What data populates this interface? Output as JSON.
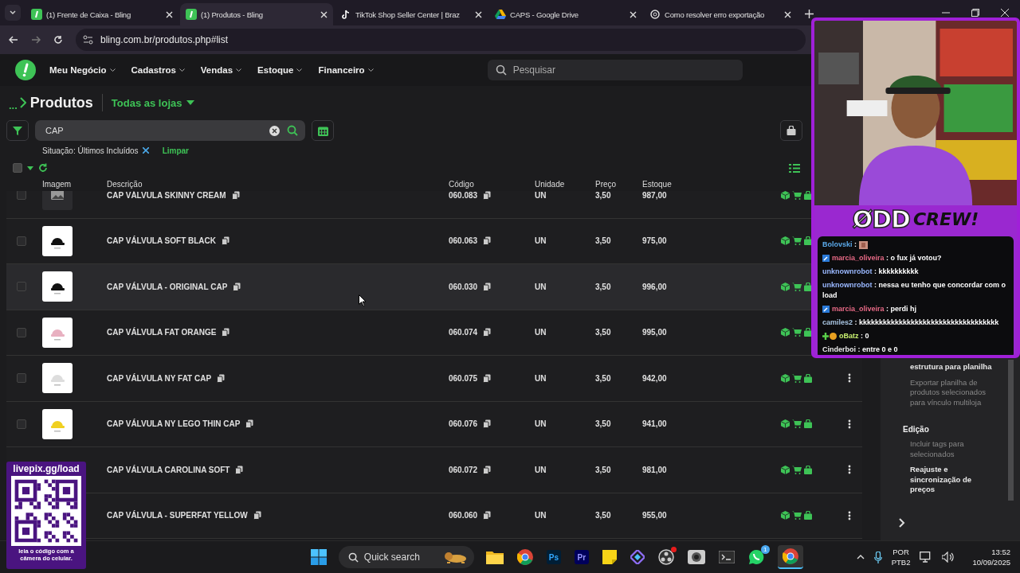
{
  "browser": {
    "tabs": [
      {
        "title": "(1) Frente de Caixa - Bling",
        "selected": false
      },
      {
        "title": "(1) Produtos - Bling",
        "selected": true
      },
      {
        "title": "TikTok Shop Seller Center | Braz",
        "selected": false
      },
      {
        "title": "CAPS - Google Drive",
        "selected": false
      },
      {
        "title": "Como resolver erro exportação",
        "selected": false
      }
    ],
    "url": "bling.com.br/produtos.php#list"
  },
  "nav": {
    "menu": [
      "Meu Negócio",
      "Cadastros",
      "Vendas",
      "Estoque",
      "Financeiro"
    ],
    "search_placeholder": "Pesquisar"
  },
  "page": {
    "breadcrumb": "...",
    "title": "Produtos",
    "store_filter": "Todas as lojas",
    "search_value": "CAP",
    "filter_label": "Situação: Últimos Incluídos",
    "clear_link": "Limpar",
    "select_all_checked": false
  },
  "table": {
    "columns": [
      "Imagem",
      "Descrição",
      "Código",
      "Unidade",
      "Preço",
      "Estoque"
    ],
    "rows": [
      {
        "description": "CAP VÁLVULA SKINNY CREAM",
        "code": "060.083",
        "unit": "UN",
        "price": "3,50",
        "stock": "987,00",
        "checked": false,
        "hovered": false
      },
      {
        "description": "CAP VÁLVULA SOFT BLACK",
        "code": "060.063",
        "unit": "UN",
        "price": "3,50",
        "stock": "975,00",
        "checked": false,
        "hovered": false
      },
      {
        "description": "CAP VÁLVULA - ORIGINAL CAP",
        "code": "060.030",
        "unit": "UN",
        "price": "3,50",
        "stock": "996,00",
        "checked": false,
        "hovered": true
      },
      {
        "description": "CAP VÁLVULA FAT ORANGE",
        "code": "060.074",
        "unit": "UN",
        "price": "3,50",
        "stock": "995,00",
        "checked": false,
        "hovered": false
      },
      {
        "description": "CAP VÁLVULA NY FAT CAP",
        "code": "060.075",
        "unit": "UN",
        "price": "3,50",
        "stock": "942,00",
        "checked": false,
        "hovered": false,
        "menu_button": true
      },
      {
        "description": "CAP VÁLVULA NY LEGO THIN CAP",
        "code": "060.076",
        "unit": "UN",
        "price": "3,50",
        "stock": "941,00",
        "checked": false,
        "hovered": false,
        "menu_button": true
      },
      {
        "description": "CAP VÁLVULA CAROLINA SOFT",
        "code": "060.072",
        "unit": "UN",
        "price": "3,50",
        "stock": "981,00",
        "hovered": false,
        "menu_button": true
      },
      {
        "description": "CAP VÁLVULA - SUPERFAT YELLOW",
        "code": "060.060",
        "unit": "UN",
        "price": "3,50",
        "stock": "955,00",
        "hovered": false,
        "menu_button": true
      }
    ]
  },
  "side_panel": {
    "sections": [
      {
        "items": [
          {
            "label": "estrutura para planilha",
            "disabled": false
          },
          {
            "label": "Exportar planilha de produtos selecionados para vínculo multiloja",
            "disabled": true
          }
        ]
      },
      {
        "title": "Edição",
        "items": [
          {
            "label": "Incluir tags para selecionados",
            "disabled": true
          },
          {
            "label": "Reajuste e sincronização de preços",
            "disabled": false
          }
        ]
      }
    ]
  },
  "stream_overlay": {
    "logo_main": "ØDD",
    "logo_tail": "CREW!",
    "chat": [
      {
        "user": "Bolovski",
        "color": "#5aa8e8",
        "text": ":",
        "emote": true
      },
      {
        "user": "marcia_oliveira",
        "color": "#e86a86",
        "text": ": o fux já votou?"
      },
      {
        "user": "unknownrobot",
        "color": "#9ab8ff",
        "text": ": kkkkkkkkkk"
      },
      {
        "user": "unknownrobot",
        "color": "#9ab8ff",
        "text": ": nessa eu tenho que concordar com o load"
      },
      {
        "user": "marcia_oliveira",
        "color": "#e86a86",
        "text": ": perdi hj"
      },
      {
        "user": "camiles2",
        "color": "#a8c4e0",
        "text": ": kkkkkkkkkkkkkkkkkkkkkkkkkkkkkkkkkkk"
      },
      {
        "user": "oBatz",
        "color": "#c8f070",
        "text": ": 0"
      },
      {
        "user": "Cinderboi",
        "color": "#e8e8e8",
        "text": ": entre 0 e 0"
      }
    ]
  },
  "qr_overlay": {
    "link": "livepix.gg/load",
    "caption": "leia o código com a câmera do celular."
  },
  "taskbar": {
    "search_placeholder": "Quick search",
    "icon_labels": [
      "Ps",
      "Pr"
    ],
    "notification_count": "1",
    "language": "POR",
    "layout": "PTB2",
    "time": "13:52",
    "date": "10/09/2025"
  }
}
